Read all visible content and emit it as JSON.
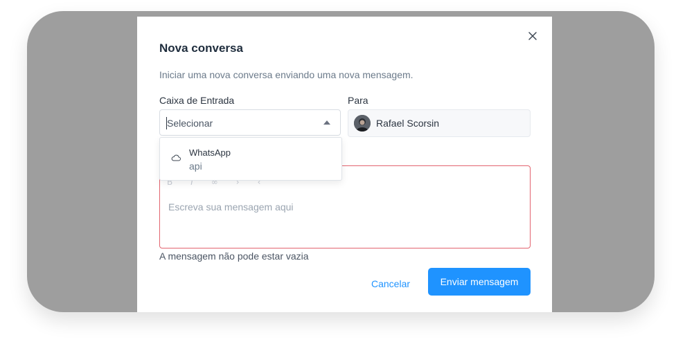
{
  "dialog": {
    "title": "Nova conversa",
    "description": "Iniciar uma nova conversa enviando uma nova mensagem."
  },
  "inbox": {
    "label": "Caixa de Entrada",
    "placeholder": "Selecionar",
    "options": [
      {
        "name": "WhatsApp",
        "subtitle": "api",
        "icon": "cloud-icon"
      }
    ]
  },
  "recipient": {
    "label": "Para",
    "name": "Rafael Scorsin"
  },
  "message": {
    "placeholder": "Escreva sua mensagem aqui",
    "toolbar_icons": [
      "bold-icon",
      "italic-icon",
      "link-icon",
      "list-icon",
      "undo-icon"
    ],
    "error": "A mensagem não pode estar vazia"
  },
  "actions": {
    "cancel": "Cancelar",
    "send": "Enviar mensagem"
  },
  "colors": {
    "accent": "#1f93ff",
    "error_border": "#e2636e",
    "backdrop": "#9e9e9e"
  }
}
